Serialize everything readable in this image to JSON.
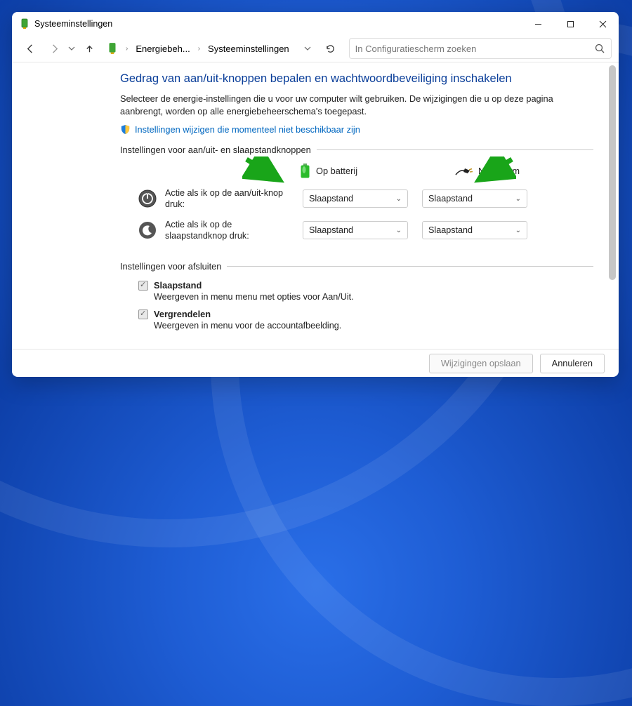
{
  "window": {
    "title": "Systeeminstellingen"
  },
  "breadcrumb": {
    "item1": "Energiebeh...",
    "item2": "Systeeminstellingen"
  },
  "search": {
    "placeholder": "In Configuratiescherm zoeken"
  },
  "page": {
    "heading": "Gedrag van aan/uit-knoppen bepalen en wachtwoordbeveiliging inschakelen",
    "intro": "Selecteer de energie-instellingen die u voor uw computer wilt gebruiken. De wijzigingen die u op deze pagina aanbrengt, worden op alle energiebeheerschema's toegepast.",
    "changeLink": "Instellingen wijzigen die momenteel niet beschikbaar zijn"
  },
  "group1": {
    "legend": "Instellingen voor aan/uit- en slaapstandknoppen",
    "colBattery": "Op batterij",
    "colPlugged": "Netstroom",
    "row1": {
      "label": "Actie als ik op de aan/uit-knop druk:",
      "valBattery": "Slaapstand",
      "valPlugged": "Slaapstand"
    },
    "row2": {
      "label": "Actie als ik op de slaapstandknop druk:",
      "valBattery": "Slaapstand",
      "valPlugged": "Slaapstand"
    }
  },
  "group2": {
    "legend": "Instellingen voor afsluiten",
    "opt1": {
      "title": "Slaapstand",
      "sub": "Weergeven in menu menu met opties voor Aan/Uit."
    },
    "opt2": {
      "title": "Vergrendelen",
      "sub": "Weergeven in menu voor de accountafbeelding."
    }
  },
  "footer": {
    "save": "Wijzigingen opslaan",
    "cancel": "Annuleren"
  }
}
